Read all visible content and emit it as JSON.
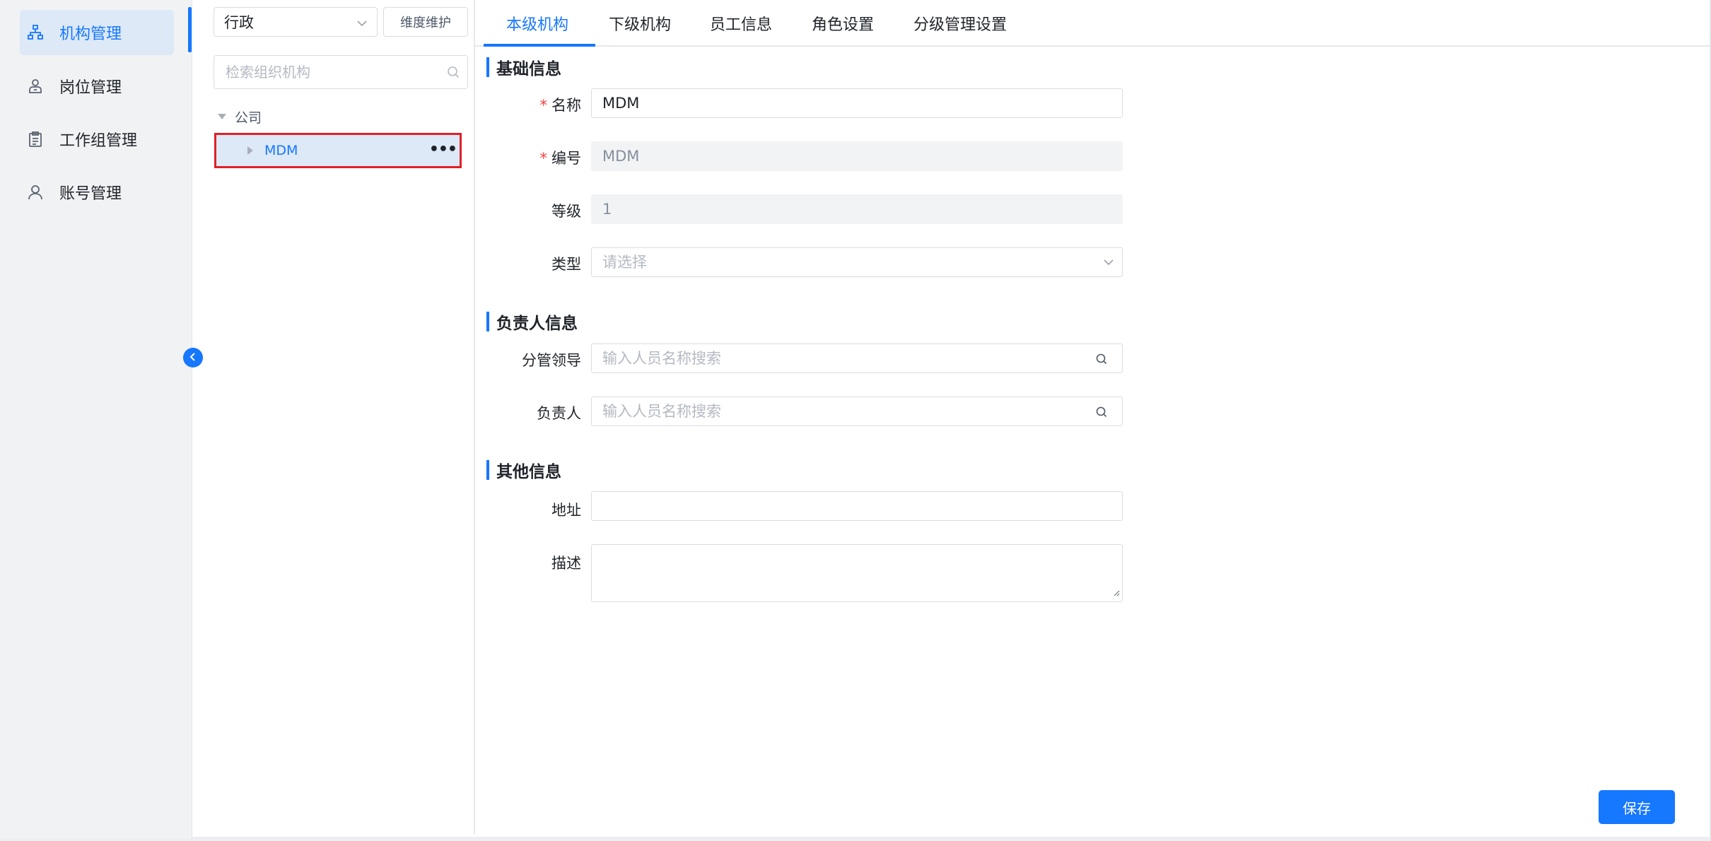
{
  "nav": {
    "items": [
      {
        "label": "机构管理",
        "icon": "org-chart-icon",
        "active": true
      },
      {
        "label": "岗位管理",
        "icon": "person-badge-icon",
        "active": false
      },
      {
        "label": "工作组管理",
        "icon": "clipboard-icon",
        "active": false
      },
      {
        "label": "账号管理",
        "icon": "user-icon",
        "active": false
      }
    ]
  },
  "tree": {
    "dimension_value": "行政",
    "dimension_button": "维度维护",
    "search_placeholder": "检索组织机构",
    "root_label": "公司",
    "selected_node": "MDM",
    "more_label": "•••"
  },
  "tabs": [
    "本级机构",
    "下级机构",
    "员工信息",
    "角色设置",
    "分级管理设置"
  ],
  "sections": {
    "basic": "基础信息",
    "owner": "负责人信息",
    "other": "其他信息"
  },
  "form": {
    "required_mark": "*",
    "name_label": "名称",
    "name_value": "MDM",
    "code_label": "编号",
    "code_value": "MDM",
    "level_label": "等级",
    "level_value": "1",
    "type_label": "类型",
    "type_placeholder": "请选择",
    "leader_label": "分管领导",
    "leader_placeholder": "输入人员名称搜索",
    "owner_label": "负责人",
    "owner_placeholder": "输入人员名称搜索",
    "address_label": "地址",
    "address_value": "",
    "desc_label": "描述",
    "desc_value": ""
  },
  "actions": {
    "save_label": "保存"
  },
  "colors": {
    "accent": "#1677ff",
    "highlight_border": "#e0202a",
    "required": "#f53f3f"
  }
}
